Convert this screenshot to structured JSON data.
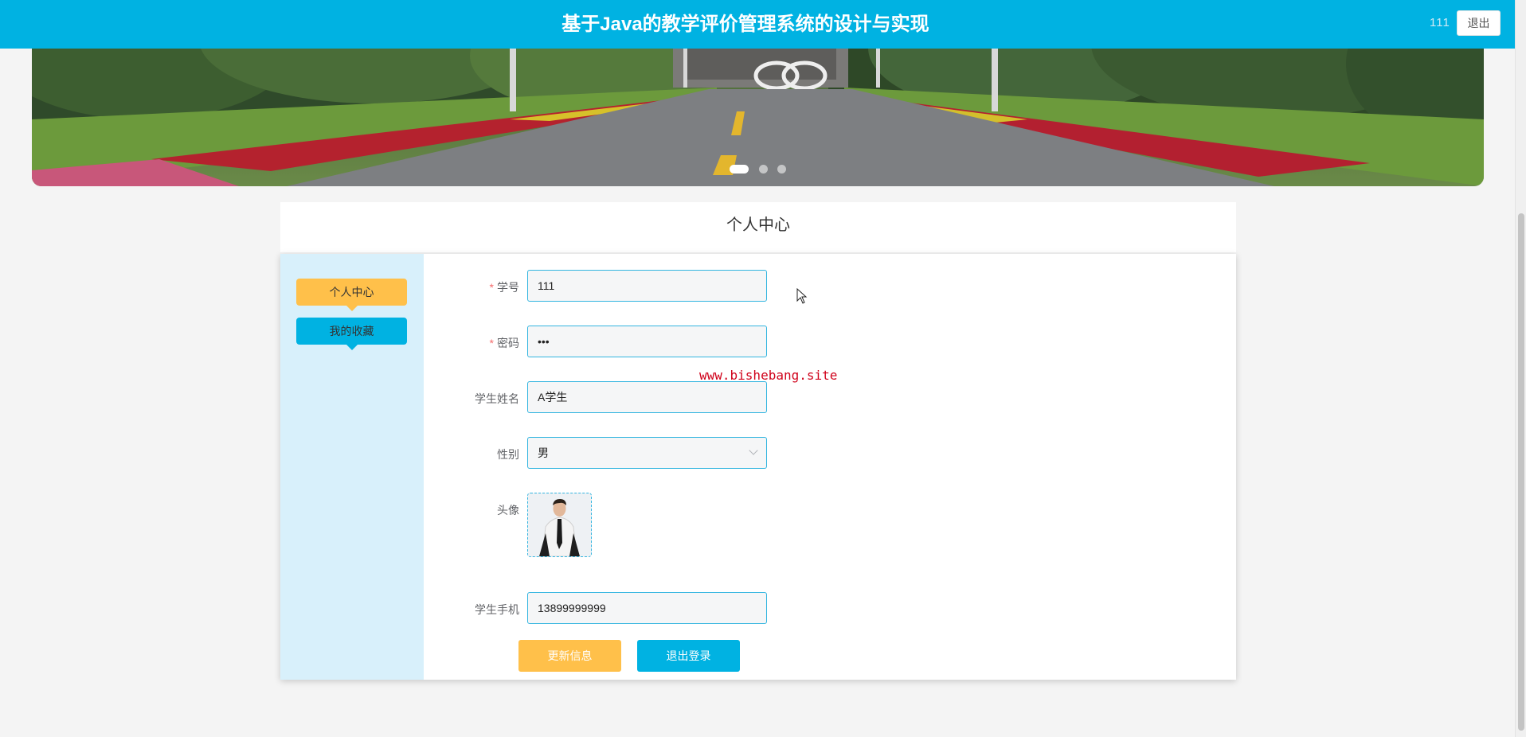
{
  "header": {
    "title": "基于Java的教学评价管理系统的设计与实现",
    "username": "111",
    "logout_label": "退出"
  },
  "banner": {
    "active_slide": 1,
    "slide_count": 3
  },
  "section": {
    "title": "个人中心"
  },
  "sidebar": {
    "items": [
      {
        "label": "个人中心",
        "active": true
      },
      {
        "label": "我的收藏",
        "active": false
      }
    ]
  },
  "form": {
    "student_id": {
      "label": "学号",
      "required": true,
      "value": "111"
    },
    "password": {
      "label": "密码",
      "required": true,
      "value": "•••"
    },
    "name": {
      "label": "学生姓名",
      "required": false,
      "value": "A学生"
    },
    "gender": {
      "label": "性别",
      "required": false,
      "value": "男"
    },
    "avatar": {
      "label": "头像"
    },
    "phone": {
      "label": "学生手机",
      "required": false,
      "value": "13899999999"
    }
  },
  "actions": {
    "update_label": "更新信息",
    "logout_label": "退出登录"
  },
  "watermark": "www.bishebang.site",
  "colors": {
    "primary": "#00b2e2",
    "accent": "#ffc04a",
    "sidebar_bg": "#d8f0fb"
  }
}
